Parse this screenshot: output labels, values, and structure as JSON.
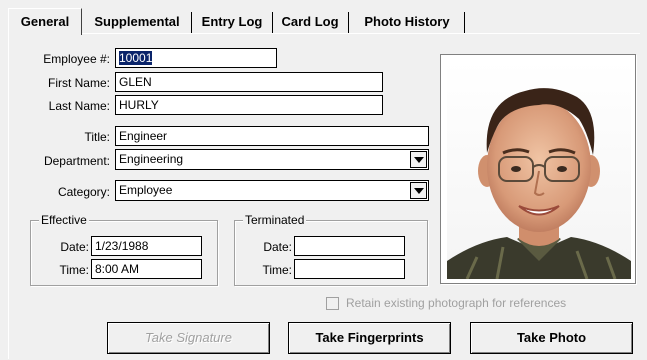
{
  "tabs": [
    {
      "label": "General",
      "active": true
    },
    {
      "label": "Supplemental"
    },
    {
      "label": "Entry Log"
    },
    {
      "label": "Card Log"
    },
    {
      "label": "Photo History"
    }
  ],
  "form": {
    "employee_label": "Employee #:",
    "employee_value": "10001",
    "first_name_label": "First Name:",
    "first_name_value": "GLEN",
    "last_name_label": "Last Name:",
    "last_name_value": "HURLY",
    "title_label": "Title:",
    "title_value": "Engineer",
    "department_label": "Department:",
    "department_value": "Engineering",
    "category_label": "Category:",
    "category_value": "Employee"
  },
  "effective": {
    "group_title": "Effective",
    "date_label": "Date:",
    "date_value": "1/23/1988",
    "time_label": "Time:",
    "time_value": "8:00 AM"
  },
  "terminated": {
    "group_title": "Terminated",
    "date_label": "Date:",
    "date_value": "",
    "time_label": "Time:",
    "time_value": ""
  },
  "retain_checkbox": {
    "label": "Retain existing photograph for references",
    "checked": false,
    "enabled": false
  },
  "buttons": {
    "take_signature": "Take Signature",
    "take_fingerprints": "Take Fingerprints",
    "take_photo": "Take Photo"
  },
  "colors": {
    "background": "#f0f0f0",
    "selection": "#0a246a",
    "disabled_text": "#a0a0a0"
  }
}
